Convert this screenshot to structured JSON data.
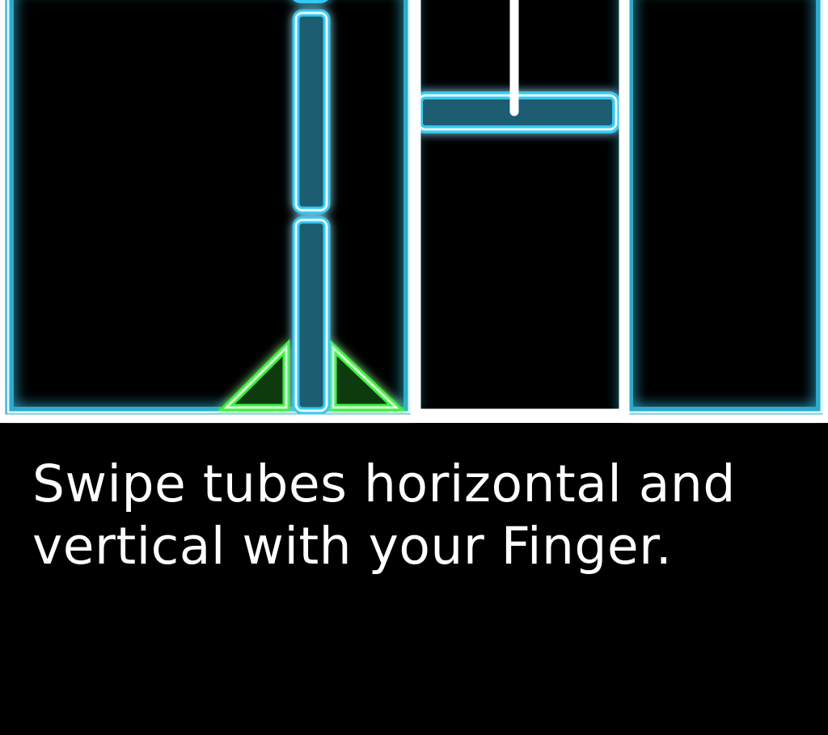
{
  "instruction": {
    "line1": "Swipe tubes horizontal and",
    "line2": "vertical with your Finger."
  },
  "colors": {
    "background": "#000000",
    "tube_glow": "#35c8f0",
    "tube_core": "#1a5d72",
    "tube_edge": "#c8f4ff",
    "frame": "#ffffff",
    "fin_glow": "#3cf03c",
    "fin_edge": "#c8ffc8"
  },
  "icons": {
    "tube_horizontal": "horizontal-tube-icon",
    "tube_vertical": "vertical-tube-icon",
    "launch_fins": "launch-fins-icon"
  }
}
